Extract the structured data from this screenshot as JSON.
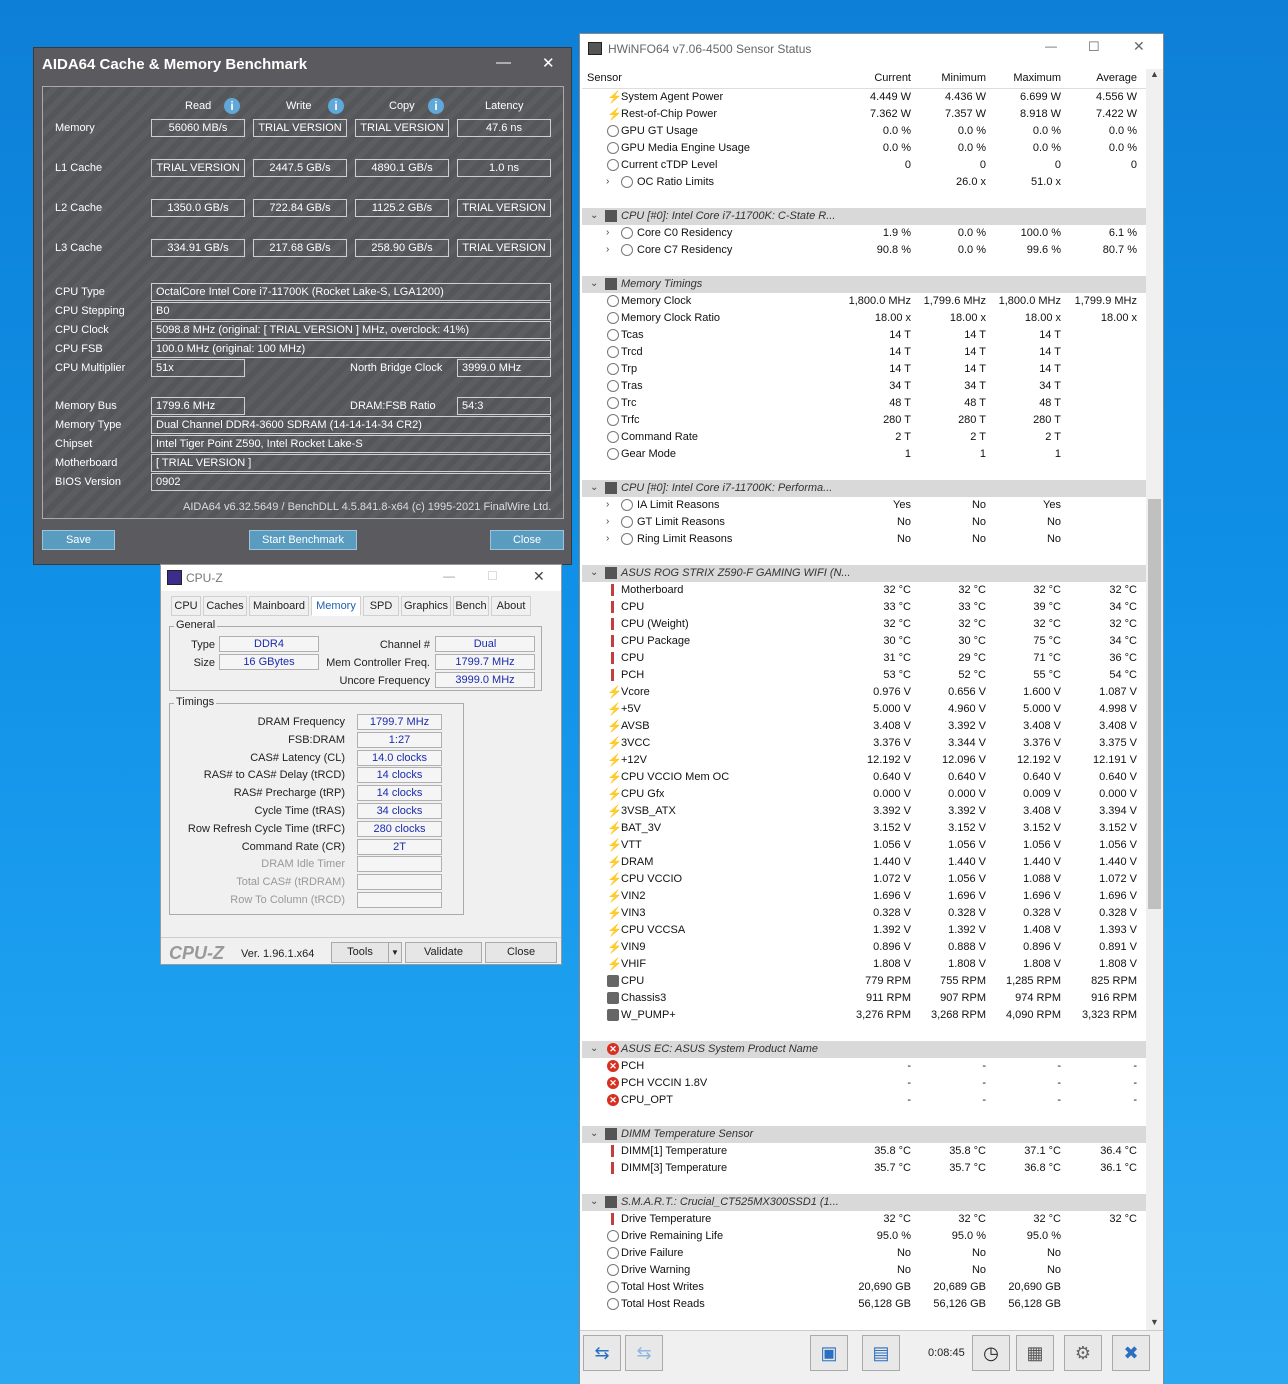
{
  "aida": {
    "title": "AIDA64 Cache & Memory Benchmark",
    "min": "—",
    "close": "✕",
    "cols": [
      "Read",
      "Write",
      "Copy",
      "Latency"
    ],
    "bench": [
      {
        "label": "Memory",
        "vals": [
          "56060 MB/s",
          "TRIAL VERSION",
          "TRIAL VERSION",
          "47.6 ns"
        ]
      },
      {
        "label": "L1 Cache",
        "vals": [
          "TRIAL VERSION",
          "2447.5 GB/s",
          "4890.1 GB/s",
          "1.0 ns"
        ]
      },
      {
        "label": "L2 Cache",
        "vals": [
          "1350.0 GB/s",
          "722.84 GB/s",
          "1125.2 GB/s",
          "TRIAL VERSION"
        ]
      },
      {
        "label": "L3 Cache",
        "vals": [
          "334.91 GB/s",
          "217.68 GB/s",
          "258.90 GB/s",
          "TRIAL VERSION"
        ]
      }
    ],
    "cpu_type_l": "CPU Type",
    "cpu_type": "OctalCore Intel Core i7-11700K  (Rocket Lake-S, LGA1200)",
    "stepping_l": "CPU Stepping",
    "stepping": "B0",
    "clock_l": "CPU Clock",
    "clock": "5098.8 MHz  (original: [ TRIAL VERSION ] MHz, overclock: 41%)",
    "fsb_l": "CPU FSB",
    "fsb": "100.0 MHz  (original: 100 MHz)",
    "mult_l": "CPU Multiplier",
    "mult": "51x",
    "nb_l": "North Bridge Clock",
    "nb": "3999.0 MHz",
    "bus_l": "Memory Bus",
    "bus": "1799.6 MHz",
    "ratio_l": "DRAM:FSB Ratio",
    "ratio": "54:3",
    "memtype_l": "Memory Type",
    "memtype": "Dual Channel DDR4-3600 SDRAM  (14-14-14-34 CR2)",
    "chipset_l": "Chipset",
    "chipset": "Intel Tiger Point Z590, Intel Rocket Lake-S",
    "mb_l": "Motherboard",
    "mb": "[ TRIAL VERSION ]",
    "bios_l": "BIOS Version",
    "bios": "0902",
    "footer": "AIDA64 v6.32.5649 / BenchDLL 4.5.841.8-x64  (c) 1995-2021 FinalWire Ltd.",
    "save": "Save",
    "start": "Start Benchmark",
    "closeb": "Close"
  },
  "cpuz": {
    "title": "CPU-Z",
    "tabs": [
      "CPU",
      "Caches",
      "Mainboard",
      "Memory",
      "SPD",
      "Graphics",
      "Bench",
      "About"
    ],
    "general": "General",
    "type_l": "Type",
    "type": "DDR4",
    "size_l": "Size",
    "size": "16 GBytes",
    "chan_l": "Channel #",
    "chan": "Dual",
    "mcf_l": "Mem Controller Freq.",
    "mcf": "1799.7 MHz",
    "unc_l": "Uncore Frequency",
    "unc": "3999.0 MHz",
    "timings": "Timings",
    "t": [
      [
        "DRAM Frequency",
        "1799.7 MHz"
      ],
      [
        "FSB:DRAM",
        "1:27"
      ],
      [
        "CAS# Latency (CL)",
        "14.0 clocks"
      ],
      [
        "RAS# to CAS# Delay (tRCD)",
        "14 clocks"
      ],
      [
        "RAS# Precharge (tRP)",
        "14 clocks"
      ],
      [
        "Cycle Time (tRAS)",
        "34 clocks"
      ],
      [
        "Row Refresh Cycle Time (tRFC)",
        "280 clocks"
      ],
      [
        "Command Rate (CR)",
        "2T"
      ],
      [
        "DRAM Idle Timer",
        ""
      ],
      [
        "Total CAS# (tRDRAM)",
        ""
      ],
      [
        "Row To Column (tRCD)",
        ""
      ]
    ],
    "logo": "CPU-Z",
    "ver": "Ver. 1.96.1.x64",
    "tools": "Tools",
    "validate": "Validate",
    "close": "Close"
  },
  "hw": {
    "title": "HWiNFO64 v7.06-4500 Sensor Status",
    "cols": [
      "Sensor",
      "Current",
      "Minimum",
      "Maximum",
      "Average"
    ],
    "time": "0:08:45",
    "rows": [
      [
        "b",
        "System Agent Power",
        "4.449 W",
        "4.436 W",
        "6.699 W",
        "4.556 W"
      ],
      [
        "b",
        "Rest-of-Chip Power",
        "7.362 W",
        "7.357 W",
        "8.918 W",
        "7.422 W"
      ],
      [
        "k",
        "GPU GT Usage",
        "0.0 %",
        "0.0 %",
        "0.0 %",
        "0.0 %"
      ],
      [
        "k",
        "GPU Media Engine Usage",
        "0.0 %",
        "0.0 %",
        "0.0 %",
        "0.0 %"
      ],
      [
        "k",
        "Current cTDP Level",
        "0",
        "0",
        "0",
        "0"
      ],
      [
        "ks",
        "OC Ratio Limits",
        "",
        "26.0 x",
        "51.0 x",
        ""
      ],
      [
        "e"
      ],
      [
        "s",
        "CPU [#0]: Intel Core i7-11700K: C-State R..."
      ],
      [
        "ks",
        "Core C0 Residency",
        "1.9 %",
        "0.0 %",
        "100.0 %",
        "6.1 %"
      ],
      [
        "ks",
        "Core C7 Residency",
        "90.8 %",
        "0.0 %",
        "99.6 %",
        "80.7 %"
      ],
      [
        "e"
      ],
      [
        "s",
        "Memory Timings"
      ],
      [
        "k",
        "Memory Clock",
        "1,800.0 MHz",
        "1,799.6 MHz",
        "1,800.0 MHz",
        "1,799.9 MHz"
      ],
      [
        "k",
        "Memory Clock Ratio",
        "18.00 x",
        "18.00 x",
        "18.00 x",
        "18.00 x"
      ],
      [
        "k",
        "Tcas",
        "14 T",
        "14 T",
        "14 T",
        ""
      ],
      [
        "k",
        "Trcd",
        "14 T",
        "14 T",
        "14 T",
        ""
      ],
      [
        "k",
        "Trp",
        "14 T",
        "14 T",
        "14 T",
        ""
      ],
      [
        "k",
        "Tras",
        "34 T",
        "34 T",
        "34 T",
        ""
      ],
      [
        "k",
        "Trc",
        "48 T",
        "48 T",
        "48 T",
        ""
      ],
      [
        "k",
        "Trfc",
        "280 T",
        "280 T",
        "280 T",
        ""
      ],
      [
        "k",
        "Command Rate",
        "2 T",
        "2 T",
        "2 T",
        ""
      ],
      [
        "k",
        "Gear Mode",
        "1",
        "1",
        "1",
        ""
      ],
      [
        "e"
      ],
      [
        "s",
        "CPU [#0]: Intel Core i7-11700K: Performa..."
      ],
      [
        "ks",
        "IA Limit Reasons",
        "Yes",
        "No",
        "Yes",
        ""
      ],
      [
        "ks",
        "GT Limit Reasons",
        "No",
        "No",
        "No",
        ""
      ],
      [
        "ks",
        "Ring Limit Reasons",
        "No",
        "No",
        "No",
        ""
      ],
      [
        "e"
      ],
      [
        "s",
        "ASUS ROG STRIX Z590-F GAMING WIFI (N..."
      ],
      [
        "t",
        "Motherboard",
        "32 °C",
        "32 °C",
        "32 °C",
        "32 °C"
      ],
      [
        "t",
        "CPU",
        "33 °C",
        "33 °C",
        "39 °C",
        "34 °C"
      ],
      [
        "t",
        "CPU (Weight)",
        "32 °C",
        "32 °C",
        "32 °C",
        "32 °C"
      ],
      [
        "t",
        "CPU Package",
        "30 °C",
        "30 °C",
        "75 °C",
        "34 °C"
      ],
      [
        "t",
        "CPU",
        "31 °C",
        "29 °C",
        "71 °C",
        "36 °C"
      ],
      [
        "t",
        "PCH",
        "53 °C",
        "52 °C",
        "55 °C",
        "54 °C"
      ],
      [
        "b",
        "Vcore",
        "0.976 V",
        "0.656 V",
        "1.600 V",
        "1.087 V"
      ],
      [
        "b",
        "+5V",
        "5.000 V",
        "4.960 V",
        "5.000 V",
        "4.998 V"
      ],
      [
        "b",
        "AVSB",
        "3.408 V",
        "3.392 V",
        "3.408 V",
        "3.408 V"
      ],
      [
        "b",
        "3VCC",
        "3.376 V",
        "3.344 V",
        "3.376 V",
        "3.375 V"
      ],
      [
        "b",
        "+12V",
        "12.192 V",
        "12.096 V",
        "12.192 V",
        "12.191 V"
      ],
      [
        "b",
        "CPU VCCIO Mem OC",
        "0.640 V",
        "0.640 V",
        "0.640 V",
        "0.640 V"
      ],
      [
        "b",
        "CPU Gfx",
        "0.000 V",
        "0.000 V",
        "0.009 V",
        "0.000 V"
      ],
      [
        "b",
        "3VSB_ATX",
        "3.392 V",
        "3.392 V",
        "3.408 V",
        "3.394 V"
      ],
      [
        "b",
        "BAT_3V",
        "3.152 V",
        "3.152 V",
        "3.152 V",
        "3.152 V"
      ],
      [
        "b",
        "VTT",
        "1.056 V",
        "1.056 V",
        "1.056 V",
        "1.056 V"
      ],
      [
        "b",
        "DRAM",
        "1.440 V",
        "1.440 V",
        "1.440 V",
        "1.440 V"
      ],
      [
        "b",
        "CPU VCCIO",
        "1.072 V",
        "1.056 V",
        "1.088 V",
        "1.072 V"
      ],
      [
        "b",
        "VIN2",
        "1.696 V",
        "1.696 V",
        "1.696 V",
        "1.696 V"
      ],
      [
        "b",
        "VIN3",
        "0.328 V",
        "0.328 V",
        "0.328 V",
        "0.328 V"
      ],
      [
        "b",
        "CPU VCCSA",
        "1.392 V",
        "1.392 V",
        "1.408 V",
        "1.393 V"
      ],
      [
        "b",
        "VIN9",
        "0.896 V",
        "0.888 V",
        "0.896 V",
        "0.891 V"
      ],
      [
        "b",
        "VHIF",
        "1.808 V",
        "1.808 V",
        "1.808 V",
        "1.808 V"
      ],
      [
        "f",
        "CPU",
        "779 RPM",
        "755 RPM",
        "1,285 RPM",
        "825 RPM"
      ],
      [
        "f",
        "Chassis3",
        "911 RPM",
        "907 RPM",
        "974 RPM",
        "916 RPM"
      ],
      [
        "f",
        "W_PUMP+",
        "3,276 RPM",
        "3,268 RPM",
        "4,090 RPM",
        "3,323 RPM"
      ],
      [
        "e"
      ],
      [
        "x",
        "ASUS EC: ASUS System Product Name"
      ],
      [
        "r",
        "PCH",
        "-",
        "-",
        "-",
        "-"
      ],
      [
        "r",
        "PCH VCCIN 1.8V",
        "-",
        "-",
        "-",
        "-"
      ],
      [
        "r",
        "CPU_OPT",
        "-",
        "-",
        "-",
        "-"
      ],
      [
        "e"
      ],
      [
        "s",
        "DIMM Temperature Sensor"
      ],
      [
        "t",
        "DIMM[1] Temperature",
        "35.8 °C",
        "35.8 °C",
        "37.1 °C",
        "36.4 °C"
      ],
      [
        "t",
        "DIMM[3] Temperature",
        "35.7 °C",
        "35.7 °C",
        "36.8 °C",
        "36.1 °C"
      ],
      [
        "e"
      ],
      [
        "s",
        "S.M.A.R.T.: Crucial_CT525MX300SSD1 (1..."
      ],
      [
        "t",
        "Drive Temperature",
        "32 °C",
        "32 °C",
        "32 °C",
        "32 °C"
      ],
      [
        "k",
        "Drive Remaining Life",
        "95.0 %",
        "95.0 %",
        "95.0 %",
        ""
      ],
      [
        "k",
        "Drive Failure",
        "No",
        "No",
        "No",
        ""
      ],
      [
        "k",
        "Drive Warning",
        "No",
        "No",
        "No",
        ""
      ],
      [
        "k",
        "Total Host Writes",
        "20,690 GB",
        "20,689 GB",
        "20,690 GB",
        ""
      ],
      [
        "k",
        "Total Host Reads",
        "56,128 GB",
        "56,126 GB",
        "56,128 GB",
        ""
      ]
    ]
  }
}
